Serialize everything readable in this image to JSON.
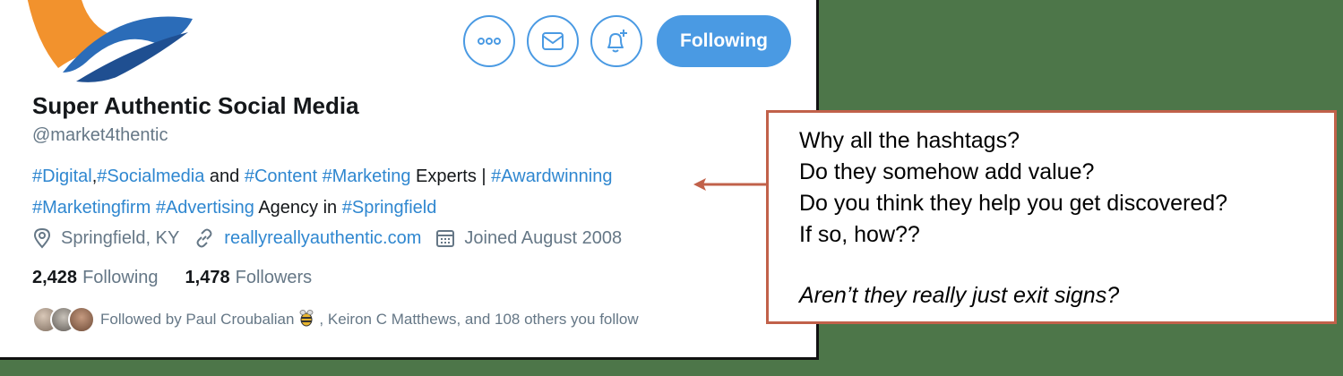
{
  "profile": {
    "name": "Super Authentic Social Media",
    "handle": "@market4thentic",
    "bio": {
      "line1": [
        {
          "text": "#Digital",
          "tag": true
        },
        {
          "text": ",",
          "tag": false
        },
        {
          "text": "#Socialmedia",
          "tag": true
        },
        {
          "text": " and ",
          "tag": false
        },
        {
          "text": "#Content",
          "tag": true
        },
        {
          "text": " ",
          "tag": false
        },
        {
          "text": "#Marketing",
          "tag": true
        },
        {
          "text": " Experts | ",
          "tag": false
        },
        {
          "text": "#Awardwinning",
          "tag": true
        }
      ],
      "line2": [
        {
          "text": "#Marketingfirm",
          "tag": true
        },
        {
          "text": " ",
          "tag": false
        },
        {
          "text": "#Advertising",
          "tag": true
        },
        {
          "text": " Agency in ",
          "tag": false
        },
        {
          "text": "#Springfield",
          "tag": true
        }
      ]
    },
    "location": "Springfield, KY",
    "website": "reallyreallyauthentic.com",
    "joined": "Joined August 2008",
    "following_count": "2,428",
    "following_label": "Following",
    "followers_count": "1,478",
    "followers_label": "Followers",
    "followed_by_prefix": "Followed by Paul Croubalian",
    "followed_by_suffix": ", Keiron C Matthews, and 108 others you follow"
  },
  "actions": {
    "more_icon": "more-icon",
    "message_icon": "mail-icon",
    "notify_icon": "bell-plus-icon",
    "follow_label": "Following"
  },
  "note": {
    "lines": [
      "Why all the hashtags?",
      "Do they somehow add value?",
      "Do you think they help you get discovered?",
      "If so, how??"
    ],
    "question": "Aren’t they really just exit signs?"
  },
  "colors": {
    "accent": "#4a9ae3",
    "hashtag": "#2f87d0",
    "note_border": "#c1614a",
    "background": "#4d7649"
  }
}
